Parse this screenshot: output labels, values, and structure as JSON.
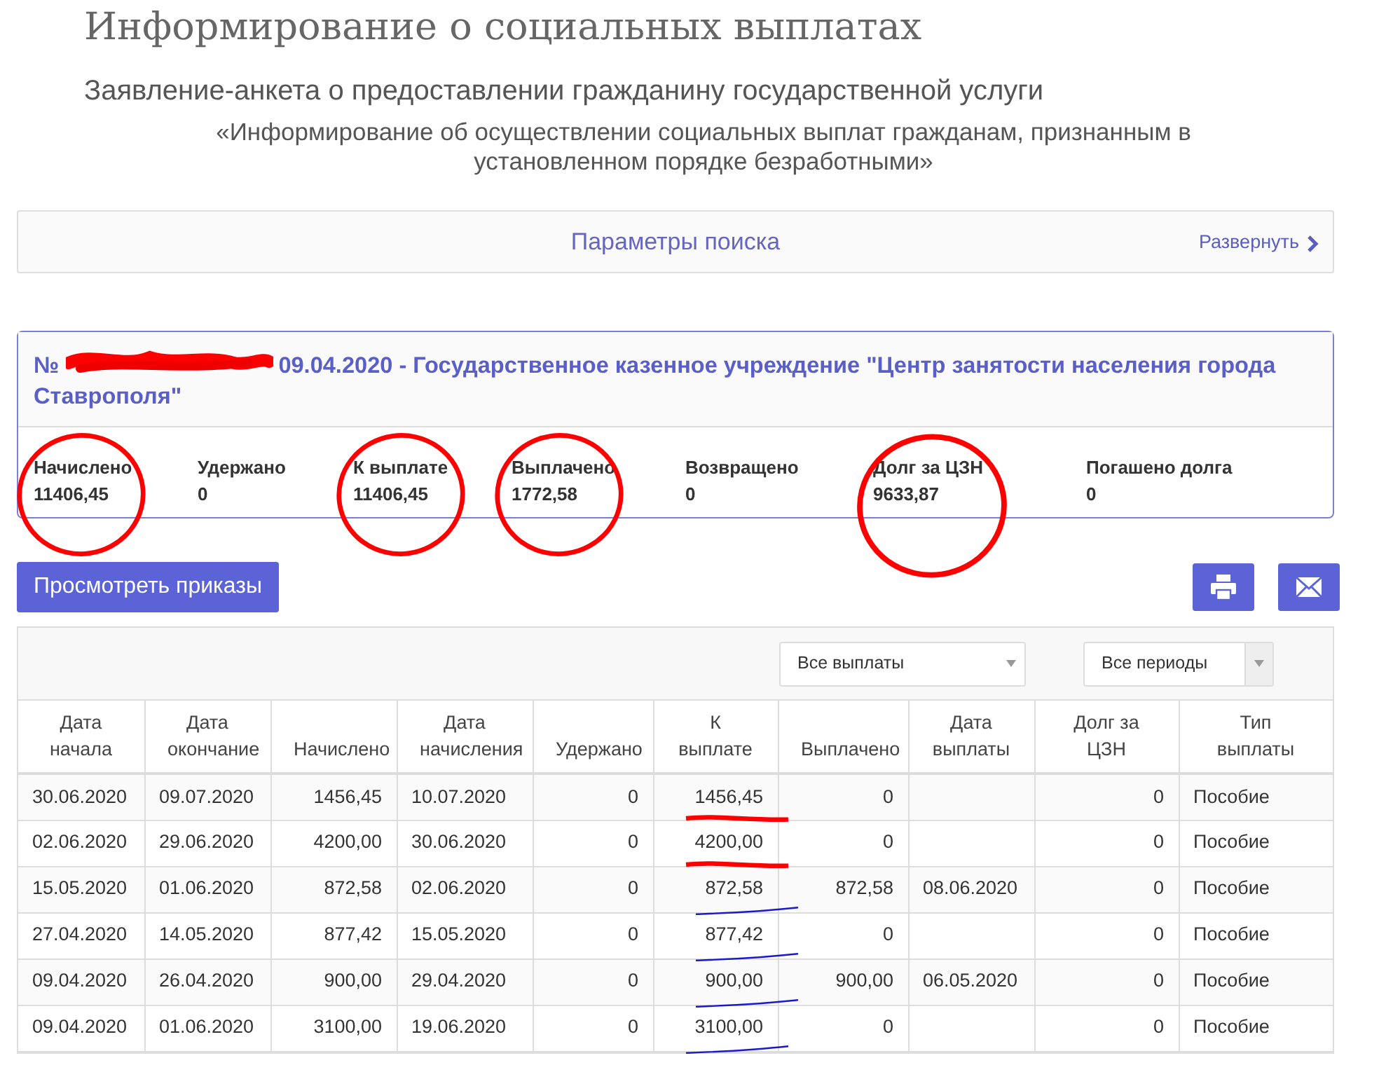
{
  "page_title": "Информирование о социальных выплатах",
  "subtitle": "Заявление-анкета о предоставлении гражданину государственной услуги",
  "service_name": "«Информирование об осуществлении социальных выплат гражданам, признанным в установленном порядке безработными»",
  "search_panel": {
    "title": "Параметры поиска",
    "toggle": "Развернуть",
    "expanded": false
  },
  "record": {
    "number_prefix": "№",
    "number_redacted": true,
    "heading": "09.04.2020 - Государственное казенное учреждение \"Центр занятости населения города Ставрополя\"",
    "stats": [
      {
        "label": "Начислено",
        "value": "11406,45",
        "circled": true
      },
      {
        "label": "Удержано",
        "value": "0",
        "circled": false
      },
      {
        "label": "К выплате",
        "value": "11406,45",
        "circled": true
      },
      {
        "label": "Выплачено",
        "value": "1772,58",
        "circled": true
      },
      {
        "label": "Возвращено",
        "value": "0",
        "circled": false
      },
      {
        "label": "Долг за ЦЗН",
        "value": "9633,87",
        "circled": true
      },
      {
        "label": "Погашено долга",
        "value": "0",
        "circled": false
      }
    ]
  },
  "orders_button": "Просмотреть приказы",
  "filters": [
    {
      "value": "Все выплаты"
    },
    {
      "value": "Все периоды"
    }
  ],
  "table": {
    "columns": [
      "Дата начала",
      "Дата окончание",
      "Начислено",
      "Дата начисления",
      "Удержано",
      "К выплате",
      "Выплачено",
      "Дата выплаты",
      "Долг за ЦЗН",
      "Тип выплаты"
    ],
    "rows": [
      {
        "cells": [
          "30.06.2020",
          "09.07.2020",
          "1456,45",
          "10.07.2020",
          "0",
          "1456,45",
          "0",
          "",
          "0",
          "Пособие"
        ],
        "annotation": {
          "color": "#ff0000"
        }
      },
      {
        "cells": [
          "02.06.2020",
          "29.06.2020",
          "4200,00",
          "30.06.2020",
          "0",
          "4200,00",
          "0",
          "",
          "0",
          "Пособие"
        ],
        "annotation": {
          "color": "#ff0000"
        }
      },
      {
        "cells": [
          "15.05.2020",
          "01.06.2020",
          "872,58",
          "02.06.2020",
          "0",
          "872,58",
          "872,58",
          "08.06.2020",
          "0",
          "Пособие"
        ],
        "annotation": {
          "color": "#1a1acc"
        }
      },
      {
        "cells": [
          "27.04.2020",
          "14.05.2020",
          "877,42",
          "15.05.2020",
          "0",
          "877,42",
          "0",
          "",
          "0",
          "Пособие"
        ],
        "annotation": {
          "color": "#1a1acc"
        }
      },
      {
        "cells": [
          "09.04.2020",
          "26.04.2020",
          "900,00",
          "29.04.2020",
          "0",
          "900,00",
          "900,00",
          "06.05.2020",
          "0",
          "Пособие"
        ],
        "annotation": {
          "color": "#1a1acc"
        }
      },
      {
        "cells": [
          "09.04.2020",
          "01.06.2020",
          "3100,00",
          "19.06.2020",
          "0",
          "3100,00",
          "0",
          "",
          "0",
          "Пособие"
        ],
        "annotation": {
          "color": "#1a1acc"
        }
      }
    ]
  }
}
